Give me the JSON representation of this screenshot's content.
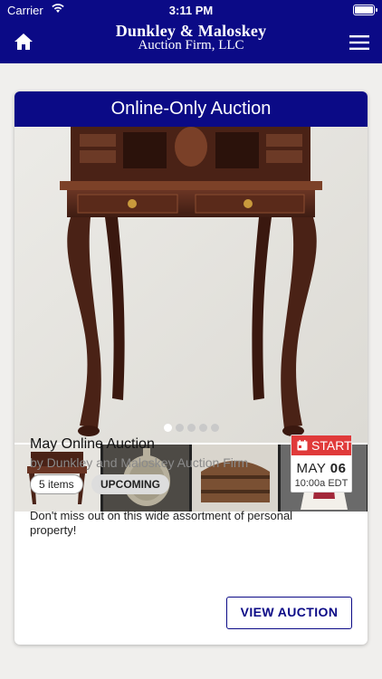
{
  "status_bar": {
    "carrier": "Carrier",
    "time": "3:11 PM"
  },
  "header": {
    "brand_line1": "Dunkley & Maloskey",
    "brand_line2": "Auction Firm, LLC",
    "home_icon": "home-icon",
    "menu_icon": "hamburger-menu-icon",
    "accent_color": "#0b0a86"
  },
  "card": {
    "title": "Online-Only Auction",
    "carousel": {
      "total": 5,
      "active_index": 0
    },
    "thumbnails": [
      "desk",
      "pocket-watch",
      "wooden-chest",
      "porcelain-doll"
    ],
    "auction_title": "May Online Auction",
    "auctioneer": "by Dunkley and Maloskey Auction Firm",
    "items_count": "5 items",
    "status": "UPCOMING",
    "date": {
      "label": "START",
      "month": "MAY",
      "day": "06",
      "time": "10:00a EDT",
      "label_color": "#e03a3a"
    },
    "description": "Don't miss out on this wide assortment of personal property!",
    "view_button": "VIEW AUCTION"
  }
}
